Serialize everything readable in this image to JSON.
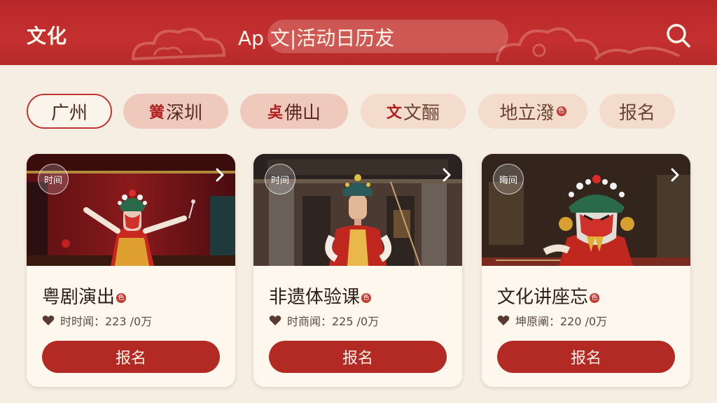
{
  "header": {
    "title": "文化",
    "search_text": "Ap 文|活动日历犮",
    "search_icon": "search-icon"
  },
  "chips": [
    {
      "mark": "",
      "label": "广州",
      "badge": ""
    },
    {
      "mark": "黉",
      "label": "深圳",
      "badge": ""
    },
    {
      "mark": "奌",
      "label": "佛山",
      "badge": ""
    },
    {
      "mark": "文",
      "label": "文酾",
      "badge": ""
    },
    {
      "mark": "",
      "label": "地立潑",
      "badge": "色"
    },
    {
      "mark": "",
      "label": "报名",
      "badge": ""
    }
  ],
  "cards": [
    {
      "time_label": "时间",
      "title": "粤剧演出",
      "badge": "色",
      "meta": "时时闻：223 /0万",
      "button": "报名"
    },
    {
      "time_label": "时间",
      "title": "非遗体验课",
      "badge": "色",
      "meta": "时商闻：225 /0万",
      "button": "报名"
    },
    {
      "time_label": "晦间",
      "title": "文化讲座忘",
      "badge": "色",
      "meta": "坤原阐：220 /0万",
      "button": "报名"
    }
  ],
  "colors": {
    "header_red": "#c4302f",
    "button_red": "#b32a25",
    "background": "#f6eee3"
  }
}
